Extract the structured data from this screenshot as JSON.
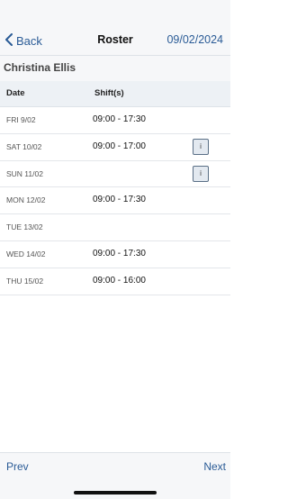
{
  "nav": {
    "back_label": "Back",
    "title": "Roster",
    "date": "09/02/2024"
  },
  "employee": {
    "name": "Christina Ellis"
  },
  "table": {
    "headers": {
      "date": "Date",
      "shift": "Shift(s)"
    },
    "rows": [
      {
        "date": "FRI 9/02",
        "shift": "09:00 - 17:30",
        "info": false
      },
      {
        "date": "SAT 10/02",
        "shift": "09:00 - 17:00",
        "info": true,
        "info_label": "i"
      },
      {
        "date": "SUN 11/02",
        "shift": "",
        "info": true,
        "info_label": "i"
      },
      {
        "date": "MON 12/02",
        "shift": "09:00 - 17:30",
        "info": false
      },
      {
        "date": "TUE 13/02",
        "shift": "",
        "info": false
      },
      {
        "date": "WED 14/02",
        "shift": "09:00 - 17:30",
        "info": false
      },
      {
        "date": "THU 15/02",
        "shift": "09:00 - 16:00",
        "info": false
      }
    ]
  },
  "footer": {
    "prev_label": "Prev",
    "next_label": "Next"
  },
  "colors": {
    "accent": "#2a5b96",
    "header_bg": "#f6f7f9",
    "table_header_bg": "#edf1f5"
  }
}
